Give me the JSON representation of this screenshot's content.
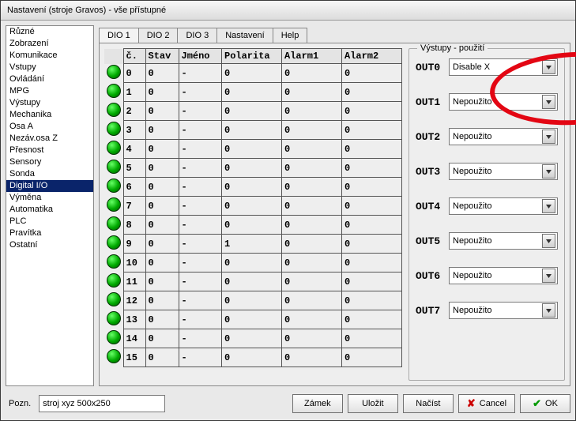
{
  "window": {
    "title": "Nastavení (stroje Gravos) - vše přístupné"
  },
  "sidebar": {
    "items": [
      "Různé",
      "Zobrazení",
      "Komunikace",
      "Vstupy",
      "Ovládání",
      "MPG",
      "Výstupy",
      "Mechanika",
      "Osa A",
      "Nezáv.osa Z",
      "Přesnost",
      "Sensory",
      "Sonda",
      "Digital I/O",
      "Výměna",
      "Automatika",
      "PLC",
      "Pravítka",
      "Ostatní"
    ],
    "selected_index": 13
  },
  "tabs": {
    "items": [
      "DIO 1",
      "DIO 2",
      "DIO 3",
      "Nastavení",
      "Help"
    ],
    "active_index": 0
  },
  "io_table": {
    "headers": [
      "č.",
      "Stav",
      "Jméno",
      "Polarita",
      "Alarm1",
      "Alarm2"
    ],
    "rows": [
      {
        "num": "0",
        "stav": "0",
        "jmeno": "-",
        "pol": "0",
        "a1": "0",
        "a2": "0"
      },
      {
        "num": "1",
        "stav": "0",
        "jmeno": "-",
        "pol": "0",
        "a1": "0",
        "a2": "0"
      },
      {
        "num": "2",
        "stav": "0",
        "jmeno": "-",
        "pol": "0",
        "a1": "0",
        "a2": "0"
      },
      {
        "num": "3",
        "stav": "0",
        "jmeno": "-",
        "pol": "0",
        "a1": "0",
        "a2": "0"
      },
      {
        "num": "4",
        "stav": "0",
        "jmeno": "-",
        "pol": "0",
        "a1": "0",
        "a2": "0"
      },
      {
        "num": "5",
        "stav": "0",
        "jmeno": "-",
        "pol": "0",
        "a1": "0",
        "a2": "0"
      },
      {
        "num": "6",
        "stav": "0",
        "jmeno": "-",
        "pol": "0",
        "a1": "0",
        "a2": "0"
      },
      {
        "num": "7",
        "stav": "0",
        "jmeno": "-",
        "pol": "0",
        "a1": "0",
        "a2": "0"
      },
      {
        "num": "8",
        "stav": "0",
        "jmeno": "-",
        "pol": "0",
        "a1": "0",
        "a2": "0"
      },
      {
        "num": "9",
        "stav": "0",
        "jmeno": "-",
        "pol": "1",
        "a1": "0",
        "a2": "0"
      },
      {
        "num": "10",
        "stav": "0",
        "jmeno": "-",
        "pol": "0",
        "a1": "0",
        "a2": "0"
      },
      {
        "num": "11",
        "stav": "0",
        "jmeno": "-",
        "pol": "0",
        "a1": "0",
        "a2": "0"
      },
      {
        "num": "12",
        "stav": "0",
        "jmeno": "-",
        "pol": "0",
        "a1": "0",
        "a2": "0"
      },
      {
        "num": "13",
        "stav": "0",
        "jmeno": "-",
        "pol": "0",
        "a1": "0",
        "a2": "0"
      },
      {
        "num": "14",
        "stav": "0",
        "jmeno": "-",
        "pol": "0",
        "a1": "0",
        "a2": "0"
      },
      {
        "num": "15",
        "stav": "0",
        "jmeno": "-",
        "pol": "0",
        "a1": "0",
        "a2": "0"
      }
    ]
  },
  "outputs": {
    "legend": "Výstupy - použití",
    "rows": [
      {
        "label": "OUT0",
        "value": "Disable X"
      },
      {
        "label": "OUT1",
        "value": "Nepoužito"
      },
      {
        "label": "OUT2",
        "value": "Nepoužito"
      },
      {
        "label": "OUT3",
        "value": "Nepoužito"
      },
      {
        "label": "OUT4",
        "value": "Nepoužito"
      },
      {
        "label": "OUT5",
        "value": "Nepoužito"
      },
      {
        "label": "OUT6",
        "value": "Nepoužito"
      },
      {
        "label": "OUT7",
        "value": "Nepoužito"
      }
    ]
  },
  "footer": {
    "pozn_label": "Pozn.",
    "pozn_value": "stroj xyz 500x250",
    "zamek": "Zámek",
    "ulozit": "Uložit",
    "nacist": "Načíst",
    "cancel": "Cancel",
    "ok": "OK"
  }
}
